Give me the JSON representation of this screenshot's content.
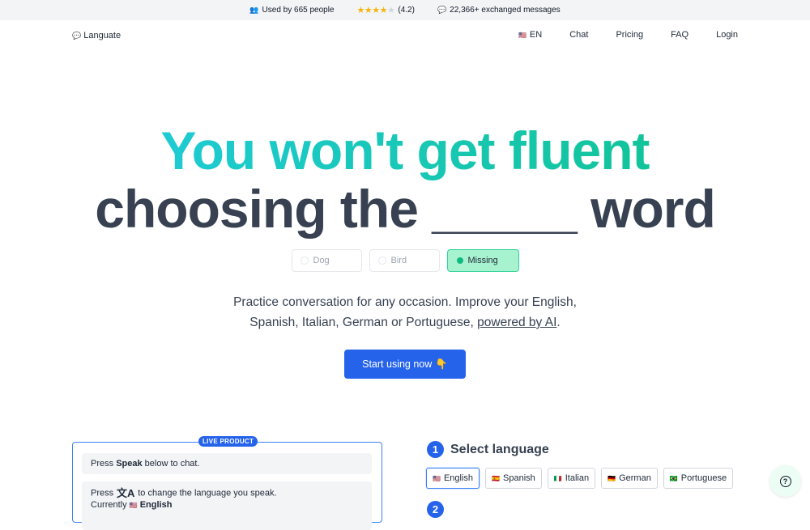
{
  "topbar": {
    "users_icon": "people-icon",
    "users_text": "Used by 665 people",
    "rating": 4.2,
    "rating_text": "(4.2)",
    "messages_icon": "speech-bubble-icon",
    "messages_text": "22,366+ exchanged messages"
  },
  "nav": {
    "logo_icon": "speech-bubble-icon",
    "logo_text": "Languate",
    "lang_flag": "🇺🇸",
    "lang_label": "EN",
    "links": [
      "Chat",
      "Pricing",
      "FAQ",
      "Login"
    ]
  },
  "hero": {
    "line1": "You won't get fluent",
    "line2": "choosing the _____ word",
    "options": [
      "Dog",
      "Bird",
      "Missing"
    ],
    "selected_option": "Missing",
    "desc_line1": "Practice conversation for any occasion. Improve your English,",
    "desc_line2": "Spanish, Italian, German or Portuguese,",
    "desc_link": "powered by AI",
    "desc_end": ".",
    "cta_label": "Start using now",
    "cta_emoji": "👇"
  },
  "demo": {
    "badge": "LIVE PRODUCT",
    "msg1_pre": "Press ",
    "msg1_bold": "Speak",
    "msg1_post": " below to chat.",
    "msg2_pre": "Press",
    "msg2_post": "to change the language you speak.",
    "msg2_line2_pre": "Currently ",
    "msg2_line2_flag": "🇺🇸",
    "msg2_line2_bold": "English"
  },
  "select_language": {
    "step": "1",
    "title": "Select language",
    "languages": [
      {
        "flag": "🇺🇸",
        "name": "English"
      },
      {
        "flag": "🇪🇸",
        "name": "Spanish"
      },
      {
        "flag": "🇮🇹",
        "name": "Italian"
      },
      {
        "flag": "🇩🇪",
        "name": "German"
      },
      {
        "flag": "🇧🇷",
        "name": "Portuguese"
      }
    ],
    "selected": "English",
    "next_step": "2"
  },
  "colors": {
    "primary": "#2563eb",
    "accent_green": "#10b981",
    "hero_gradient_start": "#1ecbd3",
    "hero_gradient_end": "#12c49a"
  }
}
